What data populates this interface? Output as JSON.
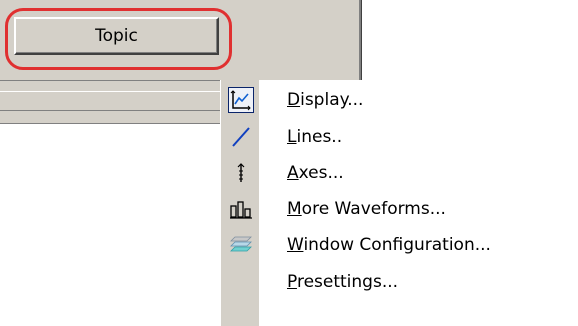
{
  "toolbar": {
    "topic_label": "Topic"
  },
  "menu": {
    "items": [
      {
        "accel": "D",
        "rest": "isplay...",
        "icon": "display-chart-icon"
      },
      {
        "accel": "L",
        "rest": "ines..",
        "icon": "line-icon"
      },
      {
        "accel": "A",
        "rest": "xes...",
        "icon": "axes-icon"
      },
      {
        "accel": "M",
        "rest": "ore Waveforms...",
        "icon": "waveforms-icon"
      },
      {
        "accel": "W",
        "rest": "indow Configuration...",
        "icon": "window-config-icon"
      },
      {
        "accel": "P",
        "rest": "resettings...",
        "icon": "presettings-icon"
      }
    ]
  },
  "colors": {
    "highlight": "#e03030",
    "menu_icon_column": "#d4d0c8",
    "selection_frame": "#0a246a"
  }
}
